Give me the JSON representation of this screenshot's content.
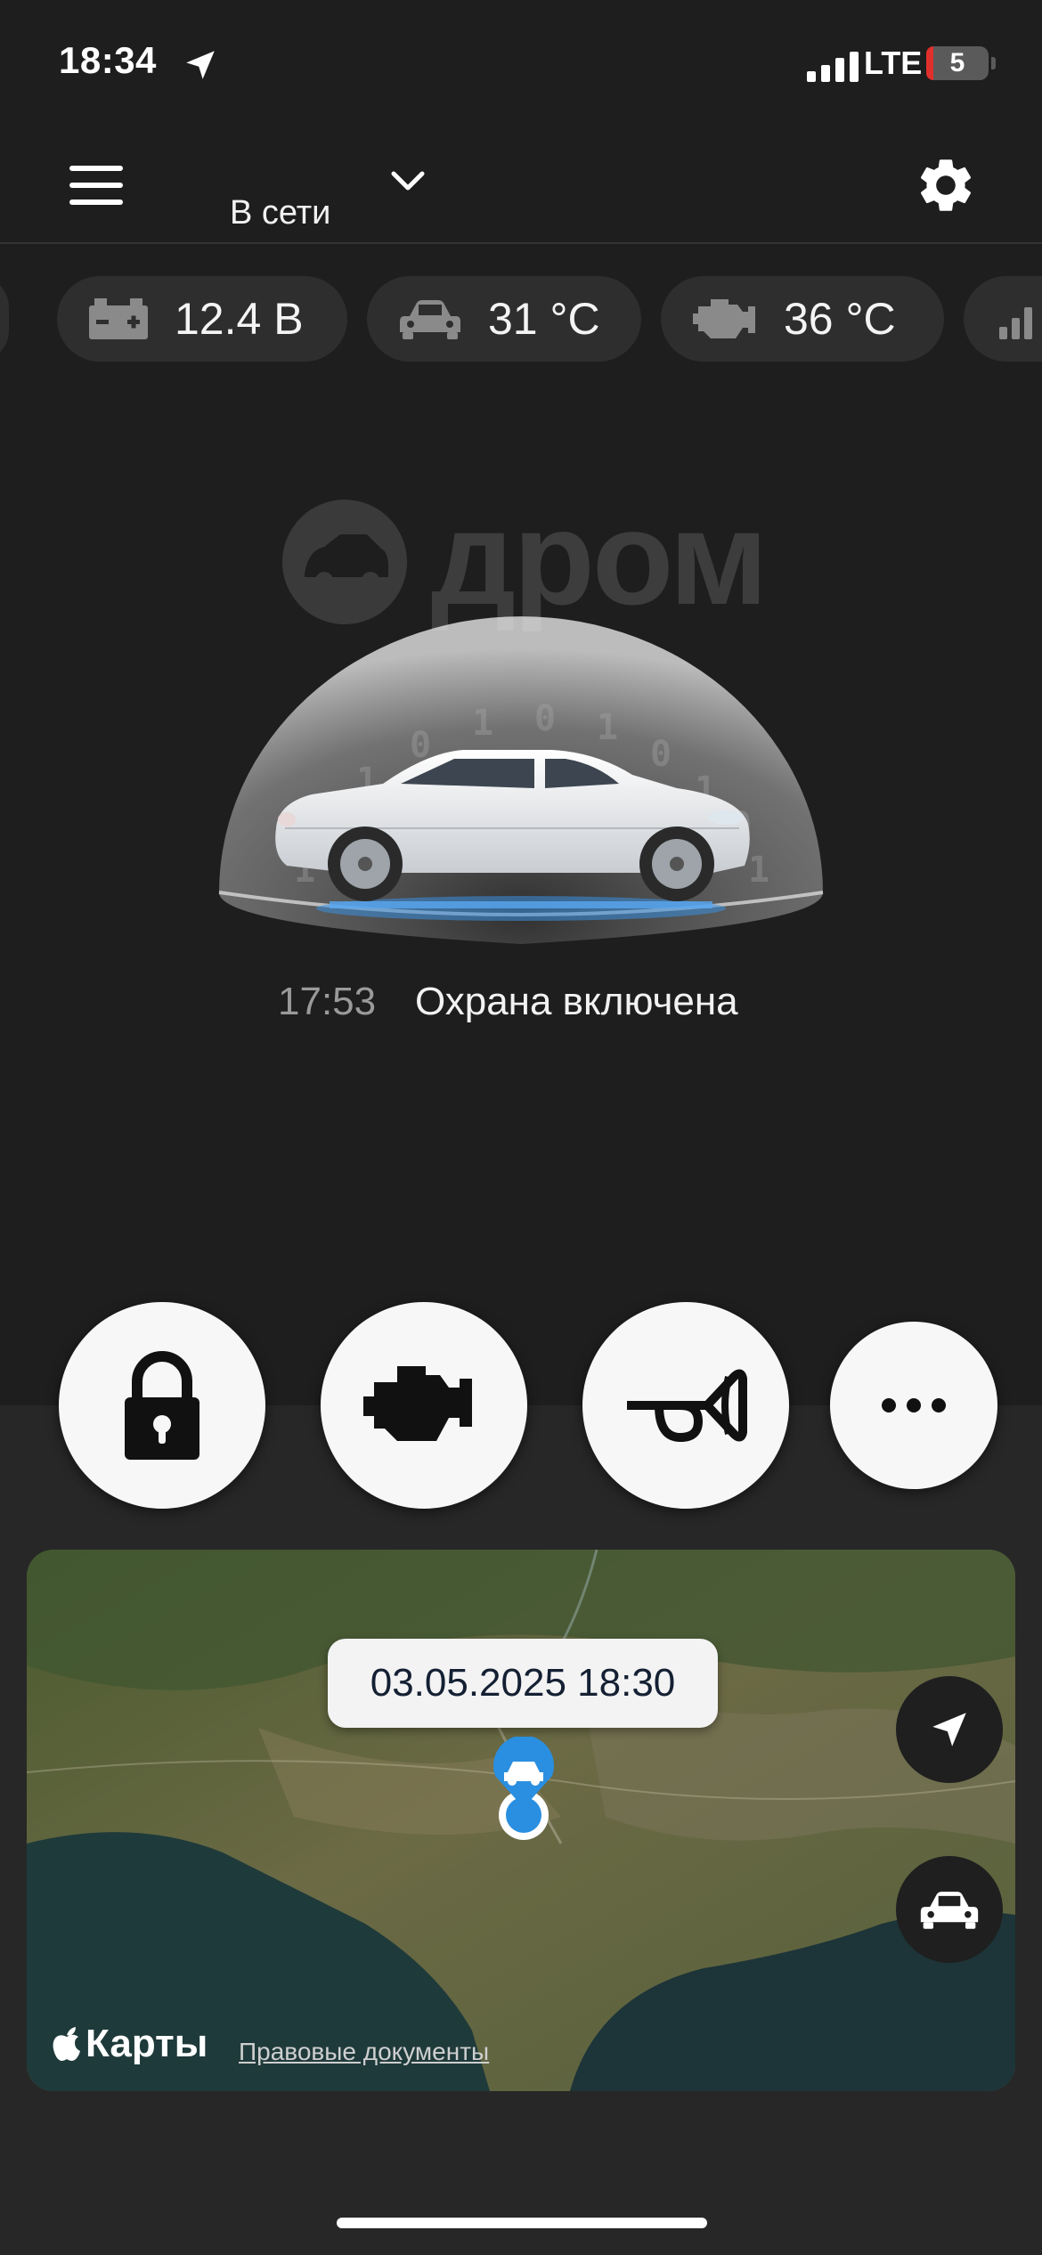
{
  "status_bar": {
    "time": "18:34",
    "network": "LTE",
    "battery": "5",
    "icons": [
      "location-arrow-icon",
      "signal-icon",
      "battery-icon"
    ]
  },
  "header": {
    "connection_status": "В сети",
    "icons": [
      "hamburger-menu-icon",
      "chevron-down-icon",
      "gear-icon"
    ]
  },
  "sensors": [
    {
      "icon": "partial-icon",
      "value": "°"
    },
    {
      "icon": "battery-icon",
      "value": "12.4 В"
    },
    {
      "icon": "car-interior-icon",
      "value": "31 °C"
    },
    {
      "icon": "engine-icon",
      "value": "36 °C"
    },
    {
      "icon": "signal-icon",
      "value": ""
    }
  ],
  "watermark": {
    "text": "дром"
  },
  "vehicle": {
    "event_time": "17:53",
    "status": "Охрана включена"
  },
  "actions": [
    {
      "name": "lock",
      "icon": "lock-icon"
    },
    {
      "name": "engine-start",
      "icon": "engine-icon"
    },
    {
      "name": "horn",
      "icon": "horn-icon"
    },
    {
      "name": "more",
      "icon": "ellipsis-icon"
    }
  ],
  "map": {
    "timestamp": "03.05.2025 18:30",
    "provider": "Карты",
    "legal_link": "Правовые документы",
    "icons": [
      "car-location-pin-icon",
      "navigate-arrow-icon",
      "car-icon"
    ]
  },
  "colors": {
    "background": "#1e1e1e",
    "chip": "#2e2e2e",
    "accent_blue": "#2a8fe0",
    "button_white": "#f7f7f7"
  }
}
